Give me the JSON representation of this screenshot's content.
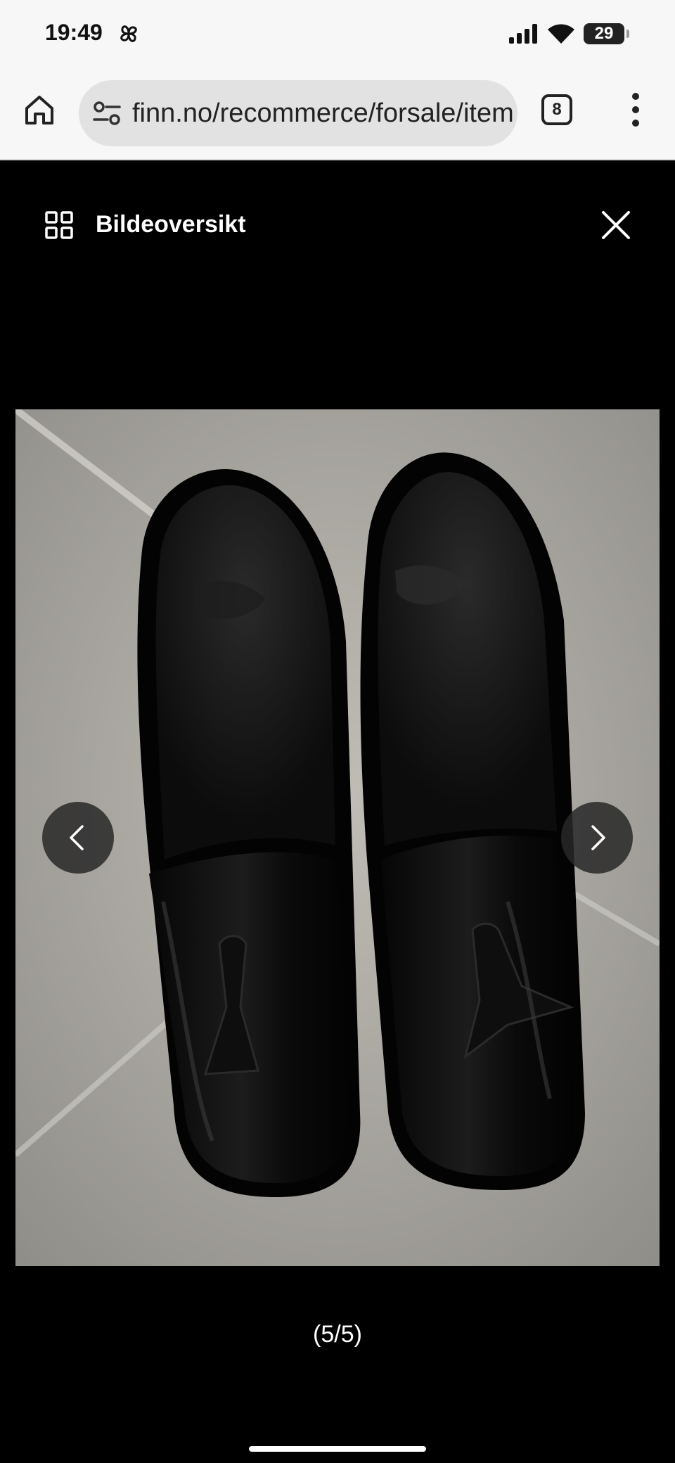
{
  "status_bar": {
    "time": "19:49",
    "battery": "29",
    "icons": [
      "pinwheel-icon",
      "signal-icon",
      "wifi-icon",
      "battery-icon"
    ]
  },
  "browser": {
    "url": "finn.no/recommerce/forsale/item",
    "tab_count": "8",
    "icons": [
      "home-icon",
      "tune-icon",
      "tabs-icon",
      "more-vert-icon"
    ]
  },
  "viewer": {
    "title": "Bildeoversikt",
    "counter": "(5/5)",
    "image_subject": "pair of black patent leather tassel loafers on a stone floor",
    "icons": [
      "grid-icon",
      "close-icon",
      "chevron-left-icon",
      "chevron-right-icon"
    ]
  },
  "colors": {
    "background": "#000000",
    "chrome": "#f7f7f7",
    "url_field": "#e2e2e2",
    "nav_button": "#282828"
  }
}
